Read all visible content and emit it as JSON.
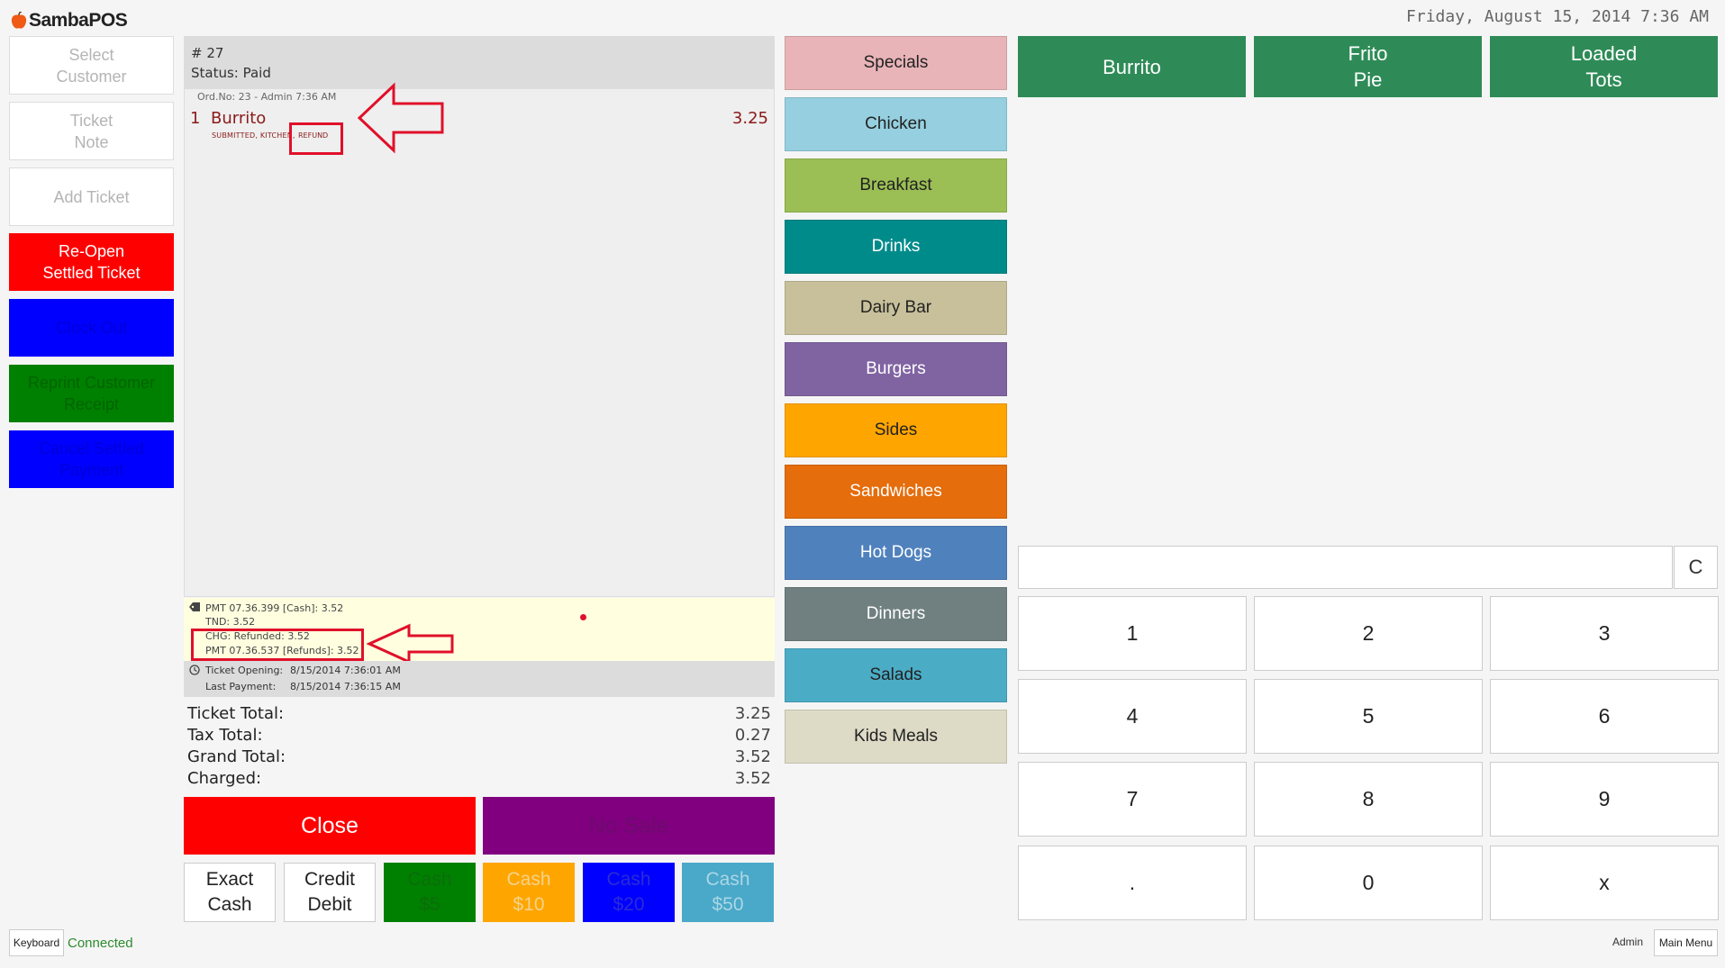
{
  "app": {
    "name": "SambaPOS",
    "datetime": "Friday, August 15, 2014 7:36 AM"
  },
  "left_buttons": [
    {
      "label": "Select\nCustomer",
      "bg": "#ffffff",
      "fg": "#b4b4b4"
    },
    {
      "label": "Ticket\nNote",
      "bg": "#ffffff",
      "fg": "#b4b4b4"
    },
    {
      "label": "Add Ticket",
      "bg": "#ffffff",
      "fg": "#b4b4b4"
    },
    {
      "label": "Re-Open\nSettled Ticket",
      "bg": "#ff0000",
      "fg": "#ffffff"
    },
    {
      "label": "Clock Out",
      "bg": "#0000ff",
      "fg": "#0000d8"
    },
    {
      "label": "Reprint Customer Receipt",
      "bg": "#008000",
      "fg": "#006400"
    },
    {
      "label": "Cancel Settled Payment",
      "bg": "#0000ff",
      "fg": "#0000d8"
    }
  ],
  "ticket": {
    "number": "# 27",
    "status": "Status: Paid",
    "order_meta": "Ord.No: 23 - Admin  7:36 AM",
    "order": {
      "qty": "1",
      "name": "Burrito",
      "price": "3.25",
      "tags": "SUBMITTED, KITCHEN,",
      "refund_tag": "REFUND"
    },
    "payments": [
      "PMT 07.36.399 [Cash]: 3.52",
      "TND: 3.52",
      "CHG: Refunded: 3.52",
      "PMT 07.36.537 [Refunds]: 3.52"
    ],
    "times": [
      {
        "label": "Ticket Opening:",
        "value": "8/15/2014 7:36:01 AM"
      },
      {
        "label": "Last Payment:",
        "value": "8/15/2014 7:36:15 AM"
      }
    ],
    "totals": [
      {
        "label": "Ticket Total:",
        "value": "3.25"
      },
      {
        "label": "Tax Total:",
        "value": "0.27"
      },
      {
        "label": "Grand Total:",
        "value": "3.52"
      },
      {
        "label": "Charged:",
        "value": "3.52"
      }
    ]
  },
  "actions": {
    "close": "Close",
    "no_sale": "No Sale"
  },
  "payment_buttons": [
    {
      "label": "Exact\nCash",
      "bg": "#ffffff",
      "fg": "#222222"
    },
    {
      "label": "Credit\nDebit",
      "bg": "#ffffff",
      "fg": "#222222"
    },
    {
      "label": "Cash\n$5",
      "bg": "#008000",
      "fg": "#0b6d0b"
    },
    {
      "label": "Cash\n$10",
      "bg": "#ffa500",
      "fg": "#f2d38a"
    },
    {
      "label": "Cash\n$20",
      "bg": "#0000ff",
      "fg": "#2b2bd8"
    },
    {
      "label": "Cash\n$50",
      "bg": "#4aa8c8",
      "fg": "#a9d7e6"
    }
  ],
  "categories": [
    {
      "label": "Specials",
      "bg": "#e8b4b8",
      "fg": "#222222"
    },
    {
      "label": "Chicken",
      "bg": "#96d0e0",
      "fg": "#222222"
    },
    {
      "label": "Breakfast",
      "bg": "#9bbf55",
      "fg": "#222222"
    },
    {
      "label": "Drinks",
      "bg": "#008b8b",
      "fg": "#ffffff"
    },
    {
      "label": "Dairy Bar",
      "bg": "#c8c09a",
      "fg": "#222222"
    },
    {
      "label": "Burgers",
      "bg": "#8064a2",
      "fg": "#ffffff"
    },
    {
      "label": "Sides",
      "bg": "#ffa500",
      "fg": "#222222"
    },
    {
      "label": "Sandwiches",
      "bg": "#e56d0c",
      "fg": "#ffffff"
    },
    {
      "label": "Hot Dogs",
      "bg": "#4f81bd",
      "fg": "#ffffff"
    },
    {
      "label": "Dinners",
      "bg": "#708080",
      "fg": "#ffffff"
    },
    {
      "label": "Salads",
      "bg": "#4bacc6",
      "fg": "#222222"
    },
    {
      "label": "Kids Meals",
      "bg": "#dddac6",
      "fg": "#222222"
    }
  ],
  "products": [
    {
      "label": "Burrito"
    },
    {
      "label": "Frito\nPie"
    },
    {
      "label": "Loaded\nTots"
    }
  ],
  "numpad": {
    "clear": "C",
    "keys": [
      "1",
      "2",
      "3",
      "4",
      "5",
      "6",
      "7",
      "8",
      "9",
      ".",
      "0",
      "x"
    ]
  },
  "footer": {
    "keyboard": "Keyboard",
    "status": "Connected",
    "user": "Admin",
    "main_menu": "Main Menu"
  }
}
